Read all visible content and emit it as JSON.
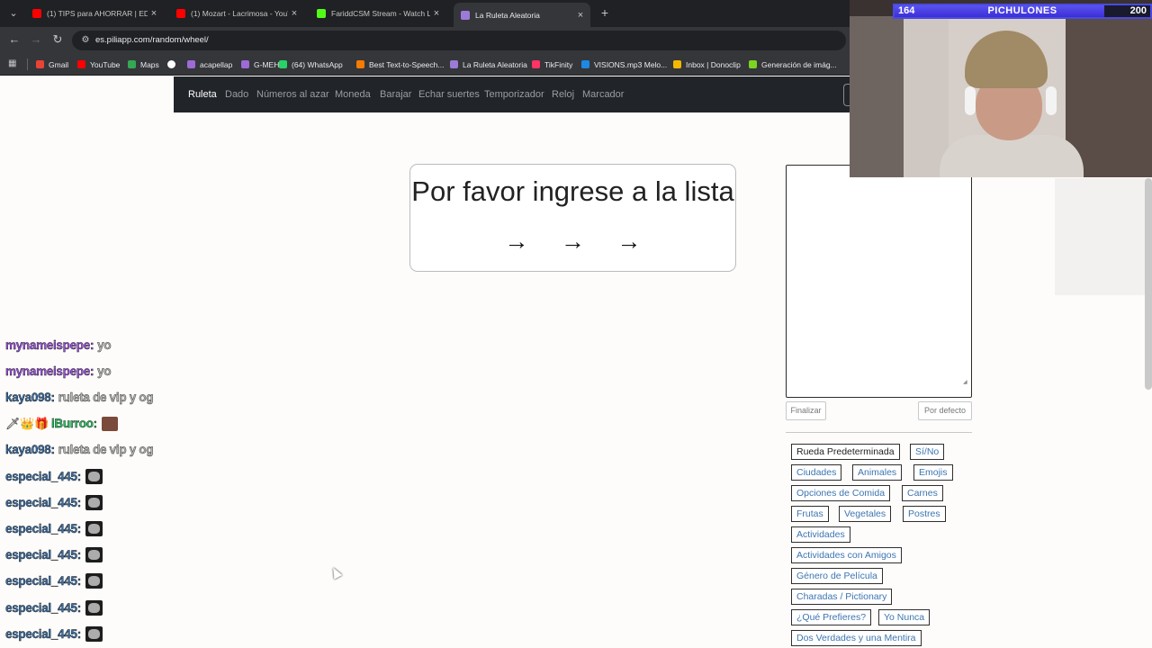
{
  "browser": {
    "tabs": [
      {
        "title": "(1) TIPS para AHORRAR | EDUC",
        "icon": "youtube-icon",
        "color": "#ff0000",
        "active": false
      },
      {
        "title": "(1) Mozart - Lacrimosa - YouTu",
        "icon": "youtube-icon",
        "color": "#ff0000",
        "active": false
      },
      {
        "title": "FariddCSM Stream - Watch Live",
        "icon": "kick-icon",
        "color": "#53fc18",
        "active": false
      },
      {
        "title": "La Ruleta Aleatoria",
        "icon": "wheel-icon",
        "color": "#9c7bd8",
        "active": true
      }
    ],
    "url": "es.piliapp.com/random/wheel/",
    "bookmarks": [
      {
        "label": "Gmail",
        "color": "#ea4335"
      },
      {
        "label": "YouTube",
        "color": "#ff0000"
      },
      {
        "label": "Maps",
        "color": "#34a853"
      },
      {
        "label": "",
        "color": "#ffffff"
      },
      {
        "label": "acapellap",
        "color": "#9c6bd6"
      },
      {
        "label": "G-MEH",
        "color": "#9c6bd6"
      },
      {
        "label": "(64) WhatsApp",
        "color": "#25d366"
      },
      {
        "label": "Best Text-to-Speech...",
        "color": "#f57c00"
      },
      {
        "label": "La Ruleta Aleatoria",
        "color": "#9c7bd8"
      },
      {
        "label": "TikFinity",
        "color": "#ff3366"
      },
      {
        "label": "VISIONS.mp3 Melo...",
        "color": "#1e88e5"
      },
      {
        "label": "Inbox | Donoclip",
        "color": "#f5b800"
      },
      {
        "label": "Generación de imág...",
        "color": "#7cd321"
      }
    ]
  },
  "site": {
    "nav": [
      "Ruleta",
      "Dado",
      "Números al azar",
      "Moneda",
      "Barajar",
      "Echar suertes",
      "Temporizador",
      "Reloj",
      "Marcador"
    ],
    "prompt": "Por favor ingrese a la lista",
    "arrows": "→ → →",
    "list_value": "",
    "finalize_label": "Finalizar",
    "default_label": "Por defecto",
    "presets": [
      "Rueda Predeterminada",
      "Sí/No",
      "Ciudades",
      "Animales",
      "Emojis",
      "Opciones de Comida",
      "Carnes",
      "Frutas",
      "Vegetales",
      "Postres",
      "Actividades",
      "Actividades con Amigos",
      "Género de Película",
      "Charadas / Pictionary",
      "¿Qué Prefieres?",
      "Yo Nunca",
      "Dos Verdades y una Mentira"
    ]
  },
  "chat": [
    {
      "user": "mynameispepe:",
      "color": "#9b4fe0",
      "msg": "yo"
    },
    {
      "user": "mynameispepe:",
      "color": "#9b4fe0",
      "msg": "yo"
    },
    {
      "user": "kaya098:",
      "color": "#3a6ea5",
      "msg": "ruleta de vip y og"
    },
    {
      "user": "iBurroo:",
      "color": "#22c55e",
      "msg": "",
      "badges": "🗡👑🎁",
      "emote": "brick"
    },
    {
      "user": "kaya098:",
      "color": "#3a6ea5",
      "msg": "ruleta de vip y og"
    },
    {
      "user": "especial_445:",
      "color": "#3a6ea5",
      "msg": "",
      "emote": "troll"
    },
    {
      "user": "especial_445:",
      "color": "#3a6ea5",
      "msg": "",
      "emote": "troll"
    },
    {
      "user": "especial_445:",
      "color": "#3a6ea5",
      "msg": "",
      "emote": "troll"
    },
    {
      "user": "especial_445:",
      "color": "#3a6ea5",
      "msg": "",
      "emote": "troll"
    },
    {
      "user": "especial_445:",
      "color": "#3a6ea5",
      "msg": "",
      "emote": "troll"
    },
    {
      "user": "especial_445:",
      "color": "#3a6ea5",
      "msg": "",
      "emote": "troll"
    },
    {
      "user": "especial_445:",
      "color": "#3a6ea5",
      "msg": "",
      "emote": "troll"
    }
  ],
  "stream_goal": {
    "current": "164",
    "label": "PICHULONES",
    "target": "200",
    "progress": 0.82
  }
}
